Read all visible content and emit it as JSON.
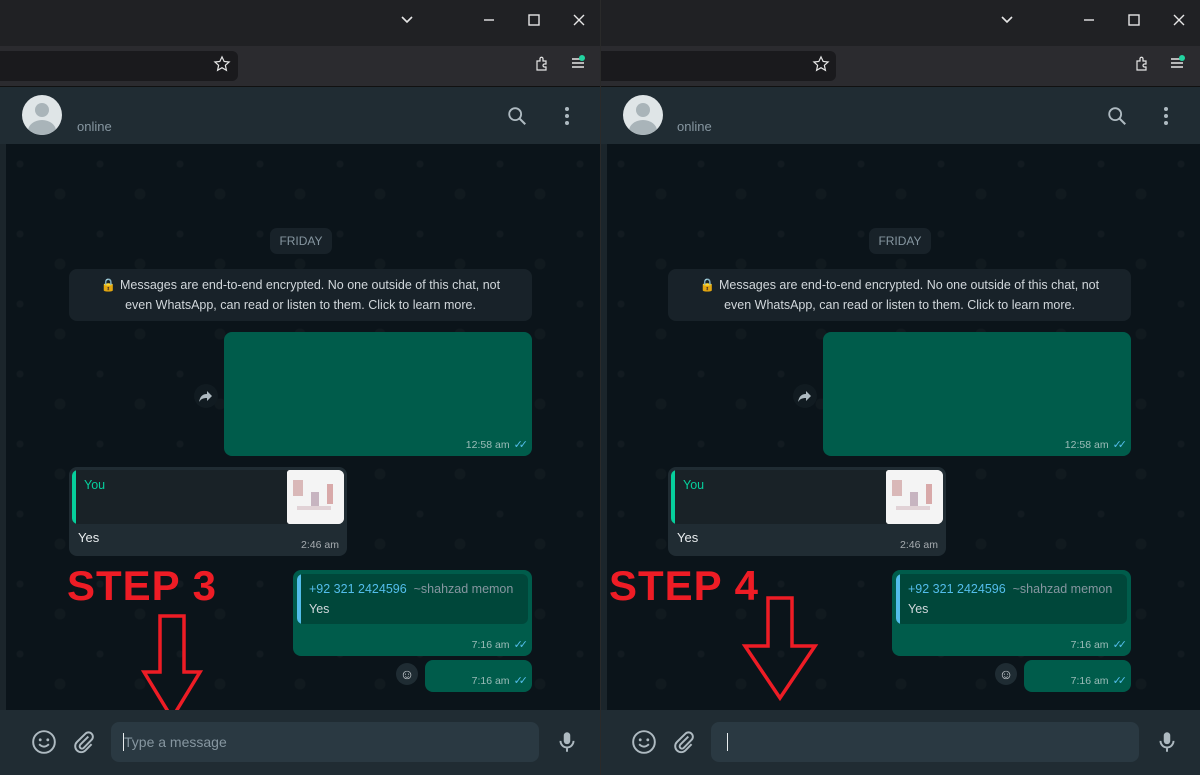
{
  "chat": {
    "status": "online",
    "day_label": "FRIDAY",
    "encryption_notice_line1": "Messages are end-to-end encrypted. No one outside of this chat, not",
    "encryption_notice_line2": "even WhatsApp, can read or listen to them. Click to learn more.",
    "messages": [
      {
        "from": "me",
        "type": "media",
        "time": "12:58 am"
      },
      {
        "from": "contact",
        "quote_author": "You",
        "text": "Yes",
        "time": "2:46 am"
      },
      {
        "from": "me",
        "quote_author": "+92 321 2424596",
        "quote_author_name": "~shahzad memon",
        "quote_text": "Yes",
        "time": "7:16 am"
      },
      {
        "from": "me",
        "type": "short",
        "time": "7:16 am"
      }
    ]
  },
  "input": {
    "placeholder": "Type a message"
  },
  "annotations": {
    "left_step": "STEP 3",
    "right_step": "STEP 4"
  },
  "colors": {
    "outgoing_bubble": "#005c4b",
    "incoming_bubble": "#202c33",
    "annotation_red": "#ee1c25",
    "read_ticks": "#53bdeb"
  }
}
